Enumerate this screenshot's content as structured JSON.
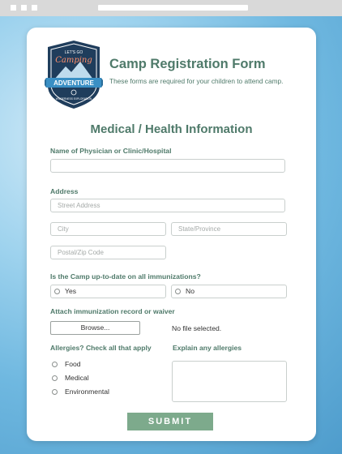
{
  "logo": {
    "top_text": "LET'S GO",
    "script_text": "Camping",
    "banner_text": "ADVENTURE",
    "bottom_text": "WILDERNESS EXPLORATION"
  },
  "header": {
    "title": "Camp Registration Form",
    "subtitle": "These forms are required for your children to attend camp."
  },
  "section_title": "Medical / Health Information",
  "physician": {
    "label": "Name of Physician or Clinic/Hospital",
    "value": ""
  },
  "address": {
    "label": "Address",
    "street_placeholder": "Street Address",
    "city_placeholder": "City",
    "state_placeholder": "State/Province",
    "postal_placeholder": "Postal/Zip Code"
  },
  "immunizations": {
    "label": "Is the Camp up-to-date on all immunizations?",
    "options": [
      "Yes",
      "No"
    ]
  },
  "attach": {
    "label": "Attach immunization record or waiver",
    "browse_label": "Browse...",
    "status": "No file selected."
  },
  "allergies": {
    "label": "Allergies? Check all that apply",
    "options": [
      "Food",
      "Medical",
      "Environmental"
    ],
    "explain_label": "Explain any allergies"
  },
  "submit_label": "SUBMIT",
  "colors": {
    "accent": "#4f7a6a",
    "button": "#7daa8c",
    "logo_navy": "#1f3d5c",
    "logo_blue": "#3a8fc4"
  }
}
